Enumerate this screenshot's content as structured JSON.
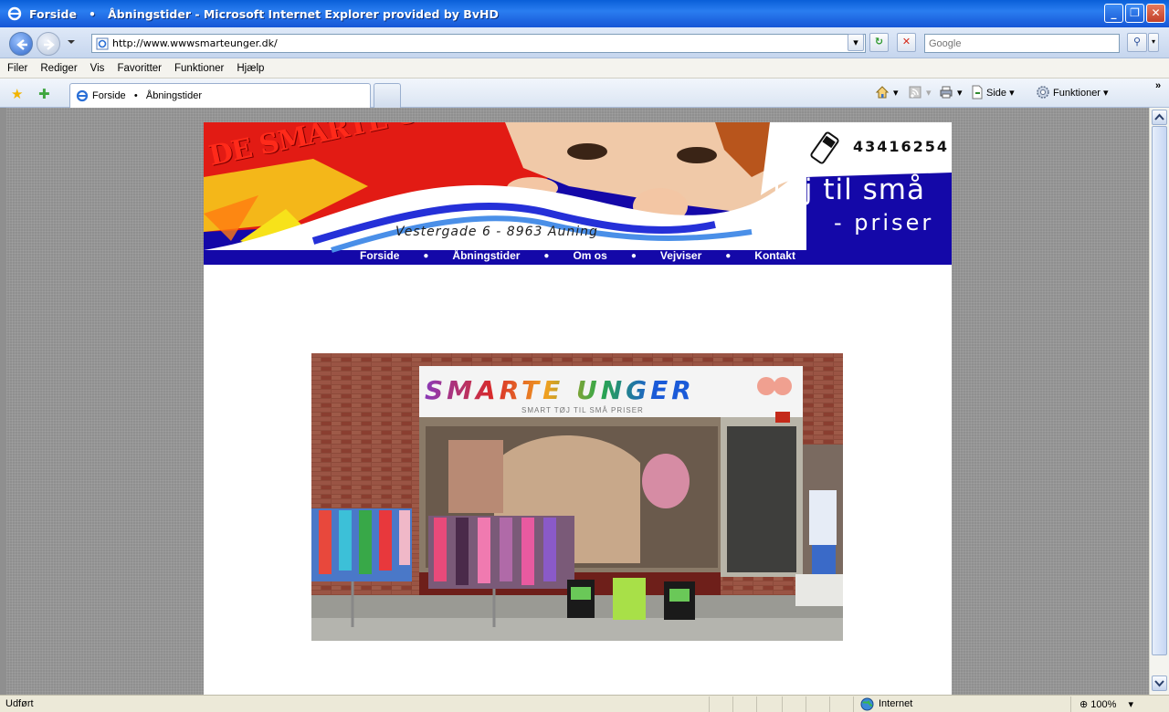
{
  "window": {
    "title": "Forside   •   Åbningstider - Microsoft Internet Explorer provided by BvHD"
  },
  "address_bar": {
    "url": "http://www.wwwsmarteunger.dk/",
    "search_placeholder": "Google"
  },
  "menu": [
    "Filer",
    "Rediger",
    "Vis",
    "Favoritter",
    "Funktioner",
    "Hjælp"
  ],
  "tab": {
    "label": "Forside   •   Åbningstider"
  },
  "commands": {
    "side": "Side",
    "funktioner": "Funktioner"
  },
  "site": {
    "brand": "DE SMARTE UNGER",
    "phone": "43416254",
    "slogan_line1": "Tøj til små",
    "slogan_line2": "- priser",
    "address": "Vestergade 6 - 8963 Auning",
    "nav": [
      "Forside",
      "Åbningstider",
      "Om os",
      "Vejviser",
      "Kontakt"
    ],
    "photo": {
      "sign": "SMARTE UNGER",
      "subsign": "SMART TØJ TIL SMÅ PRISER"
    }
  },
  "status": {
    "text": "Udført",
    "zone": "Internet",
    "zoom": "100%"
  }
}
